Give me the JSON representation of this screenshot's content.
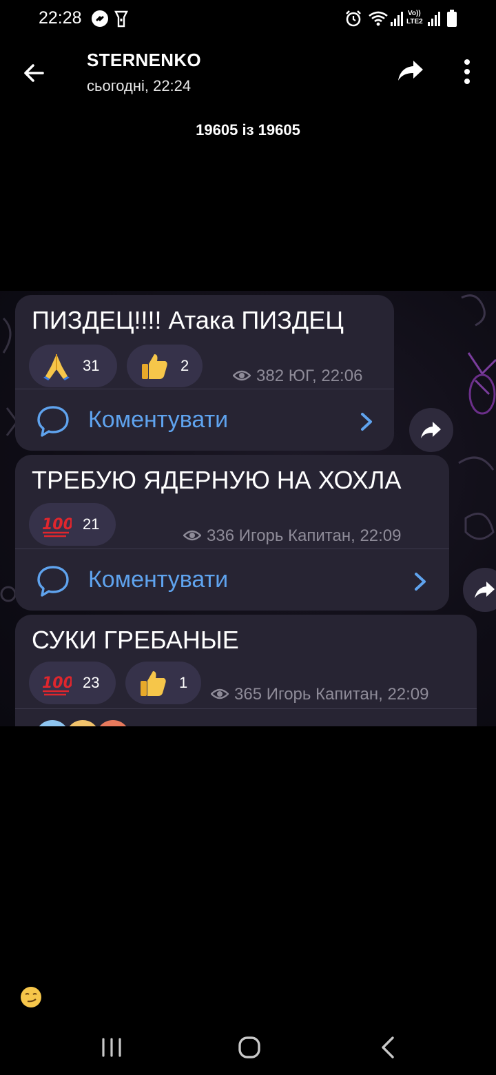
{
  "status_bar": {
    "time": "22:28",
    "icons": [
      "shazam-icon",
      "flashlight-icon",
      "alarm-icon",
      "wifi-icon",
      "signal-icon",
      "volte-lte2-icon",
      "signal-2-icon",
      "battery-icon"
    ],
    "volte_label": "Vo))",
    "lte_label": "LTE2"
  },
  "header": {
    "title": "STERNENKO",
    "subtitle": "сьогодні, 22:24"
  },
  "counter": "19605 із 19605",
  "messages": [
    {
      "text": "ПИЗДЕЦ!!!! Атака ПИЗДЕЦ",
      "reactions": [
        {
          "emoji": "folded-hands-icon",
          "count": "31"
        },
        {
          "emoji": "thumbs-up-icon",
          "count": "2"
        }
      ],
      "meta": "382 ЮГ, 22:06",
      "comment_label": "Коментувати"
    },
    {
      "text": "ТРЕБУЮ ЯДЕРНУЮ НА ХОХЛА",
      "reactions": [
        {
          "emoji": "hundred-points-icon",
          "count": "21"
        }
      ],
      "meta": "336 Игорь Капитан, 22:09",
      "comment_label": "Коментувати"
    },
    {
      "text": "СУКИ ГРЕБАНЫЕ",
      "reactions": [
        {
          "emoji": "hundred-points-icon",
          "count": "23"
        },
        {
          "emoji": "thumbs-up-icon",
          "count": "1"
        }
      ],
      "meta": "365 Игорь Капитан, 22:09"
    }
  ],
  "colors": {
    "background": "#000000",
    "bubble": "#272433",
    "reaction_pill": "#36324a",
    "link": "#5fa3ee",
    "meta": "#8e8b98"
  },
  "bottom": {
    "floating_emoji": "smirking-face-icon",
    "nav": [
      "recent-apps-icon",
      "home-icon",
      "back-nav-icon"
    ]
  }
}
